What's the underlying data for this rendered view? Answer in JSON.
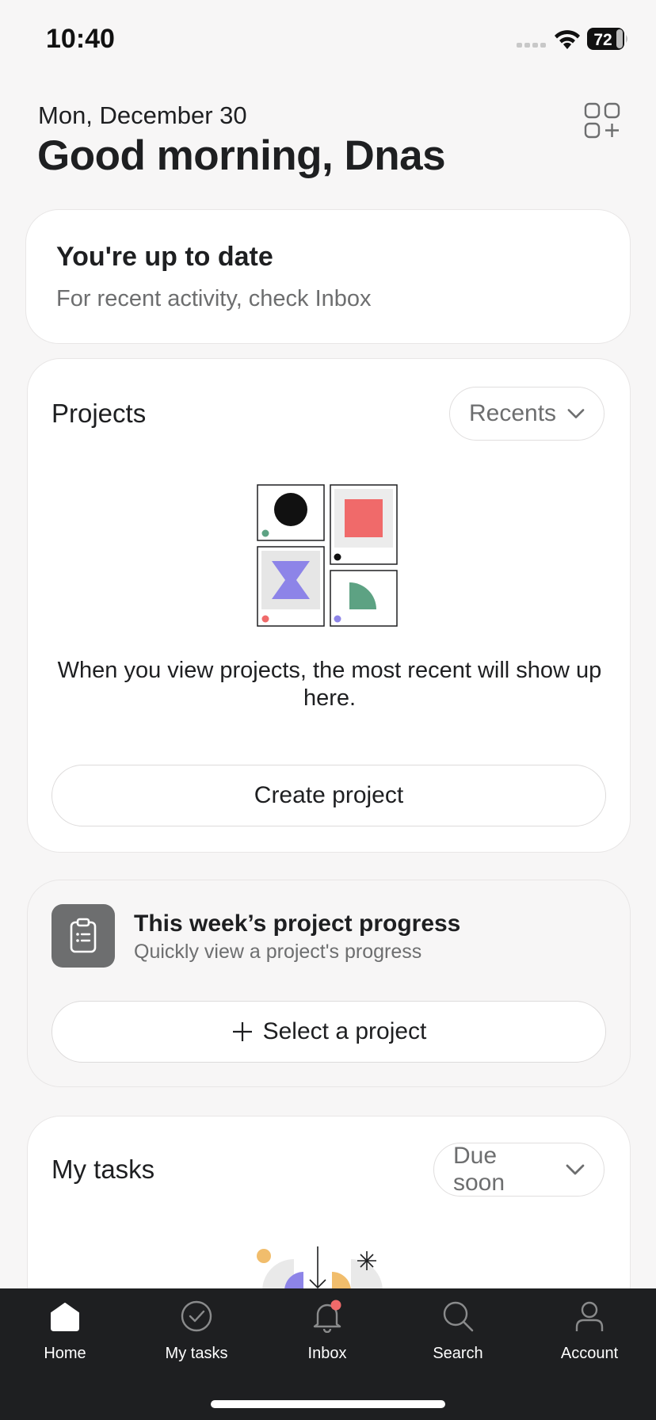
{
  "status_bar": {
    "time": "10:40",
    "battery": "72"
  },
  "header": {
    "date": "Mon, December 30",
    "greeting": "Good morning, Dnas"
  },
  "activity_card": {
    "title": "You're up to date",
    "subtitle": "For recent activity, check Inbox"
  },
  "projects_card": {
    "title": "Projects",
    "filter_label": "Recents",
    "empty_message": "When you view projects, the most recent will show up here.",
    "create_button_label": "Create project"
  },
  "progress_card": {
    "title": "This week’s project progress",
    "subtitle": "Quickly view a project's progress",
    "select_button_label": "Select a project"
  },
  "tasks_card": {
    "title": "My tasks",
    "filter_label": "Due soon"
  },
  "tab_bar": {
    "items": [
      {
        "label": "Home",
        "icon": "home-icon"
      },
      {
        "label": "My tasks",
        "icon": "check-circle-icon"
      },
      {
        "label": "Inbox",
        "icon": "bell-icon"
      },
      {
        "label": "Search",
        "icon": "search-icon"
      },
      {
        "label": "Account",
        "icon": "person-icon"
      }
    ],
    "active": "Home",
    "notification_dot_color": "#f06a6a"
  },
  "colors": {
    "background": "#f7f6f6",
    "card": "#ffffff",
    "tab_bar": "#1e1f21",
    "accent_red": "#f06a6a",
    "accent_purple": "#8d84e8",
    "accent_green": "#5da283",
    "accent_yellow": "#f1bd6c"
  }
}
